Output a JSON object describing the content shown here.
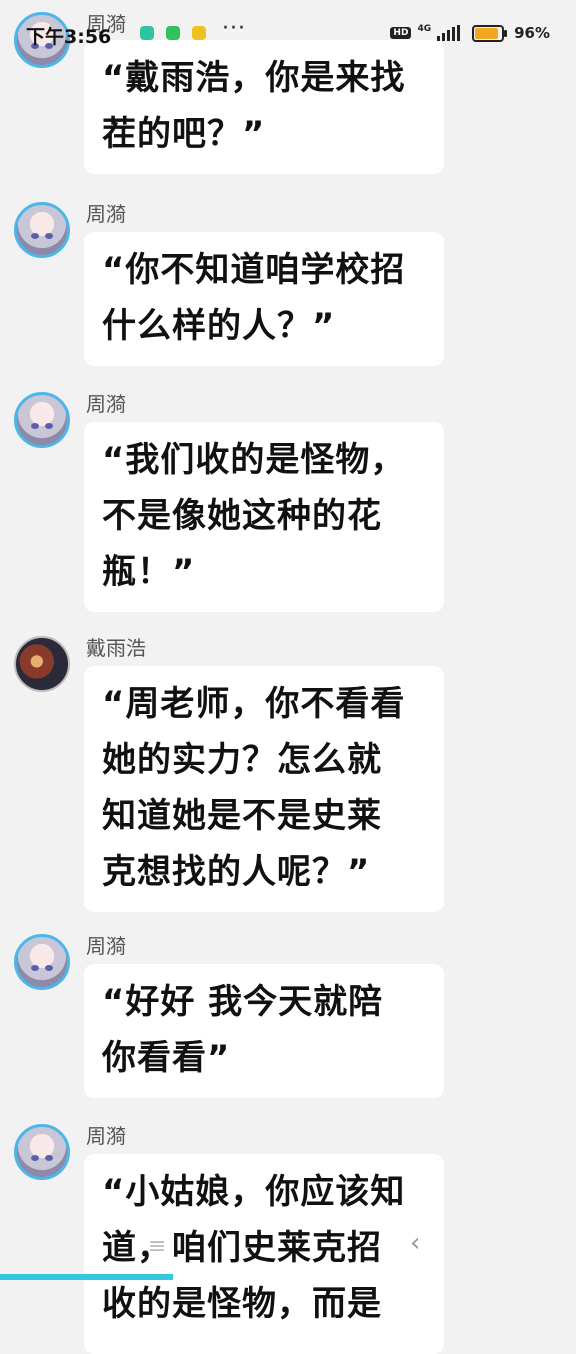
{
  "status_bar": {
    "time": "下午3:56",
    "network_badge": "HD",
    "network_type": "4G",
    "battery_percent": "96%",
    "battery_level": 0.96,
    "app_icons": [
      {
        "name": "security-app-icon",
        "color": "#2ec4a0"
      },
      {
        "name": "wechat-icon",
        "color": "#2ec45a"
      },
      {
        "name": "notes-app-icon",
        "color": "#f0c020"
      }
    ],
    "more_dots": "···"
  },
  "messages": [
    {
      "sender": "周漪",
      "avatar": "female-avatar",
      "text": "“戴雨浩，你是来找\n茬的吧？”"
    },
    {
      "sender": "周漪",
      "avatar": "female-avatar",
      "text": "“你不知道咱学校招\n什么样的人？”"
    },
    {
      "sender": "周漪",
      "avatar": "female-avatar",
      "text": "“我们收的是怪物，\n不是像她这种的花\n瓶！”"
    },
    {
      "sender": "戴雨浩",
      "avatar": "male-avatar",
      "text": "“周老师，你不看看\n她的实力？怎么就\n知道她是不是史莱\n克想找的人呢？”"
    },
    {
      "sender": "周漪",
      "avatar": "female-avatar",
      "text": "“好好 我今天就陪\n你看看”"
    },
    {
      "sender": "周漪",
      "avatar": "female-avatar",
      "text": "“小姑娘，你应该知\n道，咱们史莱克招\n收的是怪物，而是"
    }
  ],
  "nav": {
    "menu_icon": "≡",
    "back_icon": "‹"
  },
  "reading_progress": 0.3,
  "colors": {
    "background": "#f2f2f2",
    "bubble": "#ffffff",
    "avatar_ring": "#4db6e8",
    "progress": "#33c7e0",
    "battery": "#f0a820"
  }
}
